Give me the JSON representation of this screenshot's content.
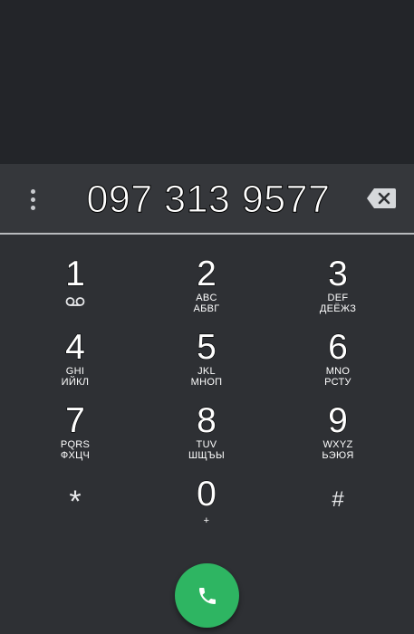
{
  "dialer": {
    "number": "097 313 9577",
    "keys": [
      {
        "digit": "1",
        "latin": "",
        "cyrillic": "",
        "icon": "voicemail-icon"
      },
      {
        "digit": "2",
        "latin": "ABC",
        "cyrillic": "АБВГ"
      },
      {
        "digit": "3",
        "latin": "DEF",
        "cyrillic": "ДЕЁЖЗ"
      },
      {
        "digit": "4",
        "latin": "GHI",
        "cyrillic": "ИЙКЛ"
      },
      {
        "digit": "5",
        "latin": "JKL",
        "cyrillic": "МНОП"
      },
      {
        "digit": "6",
        "latin": "MNO",
        "cyrillic": "РСТУ"
      },
      {
        "digit": "7",
        "latin": "PQRS",
        "cyrillic": "ФХЦЧ"
      },
      {
        "digit": "8",
        "latin": "TUV",
        "cyrillic": "ШЩЪЫ"
      },
      {
        "digit": "9",
        "latin": "WXYZ",
        "cyrillic": "ЬЭЮЯ"
      },
      {
        "digit": "*",
        "latin": "",
        "cyrillic": ""
      },
      {
        "digit": "0",
        "latin": "+",
        "cyrillic": ""
      },
      {
        "digit": "#",
        "latin": "",
        "cyrillic": ""
      }
    ]
  },
  "icons": {
    "overflow": "more-vert-icon",
    "backspace": "backspace-icon",
    "call": "phone-icon",
    "voicemail": "voicemail-icon"
  },
  "colors": {
    "call_button": "#2eb562",
    "divider": "#b8babd",
    "background": "#2e3034"
  }
}
